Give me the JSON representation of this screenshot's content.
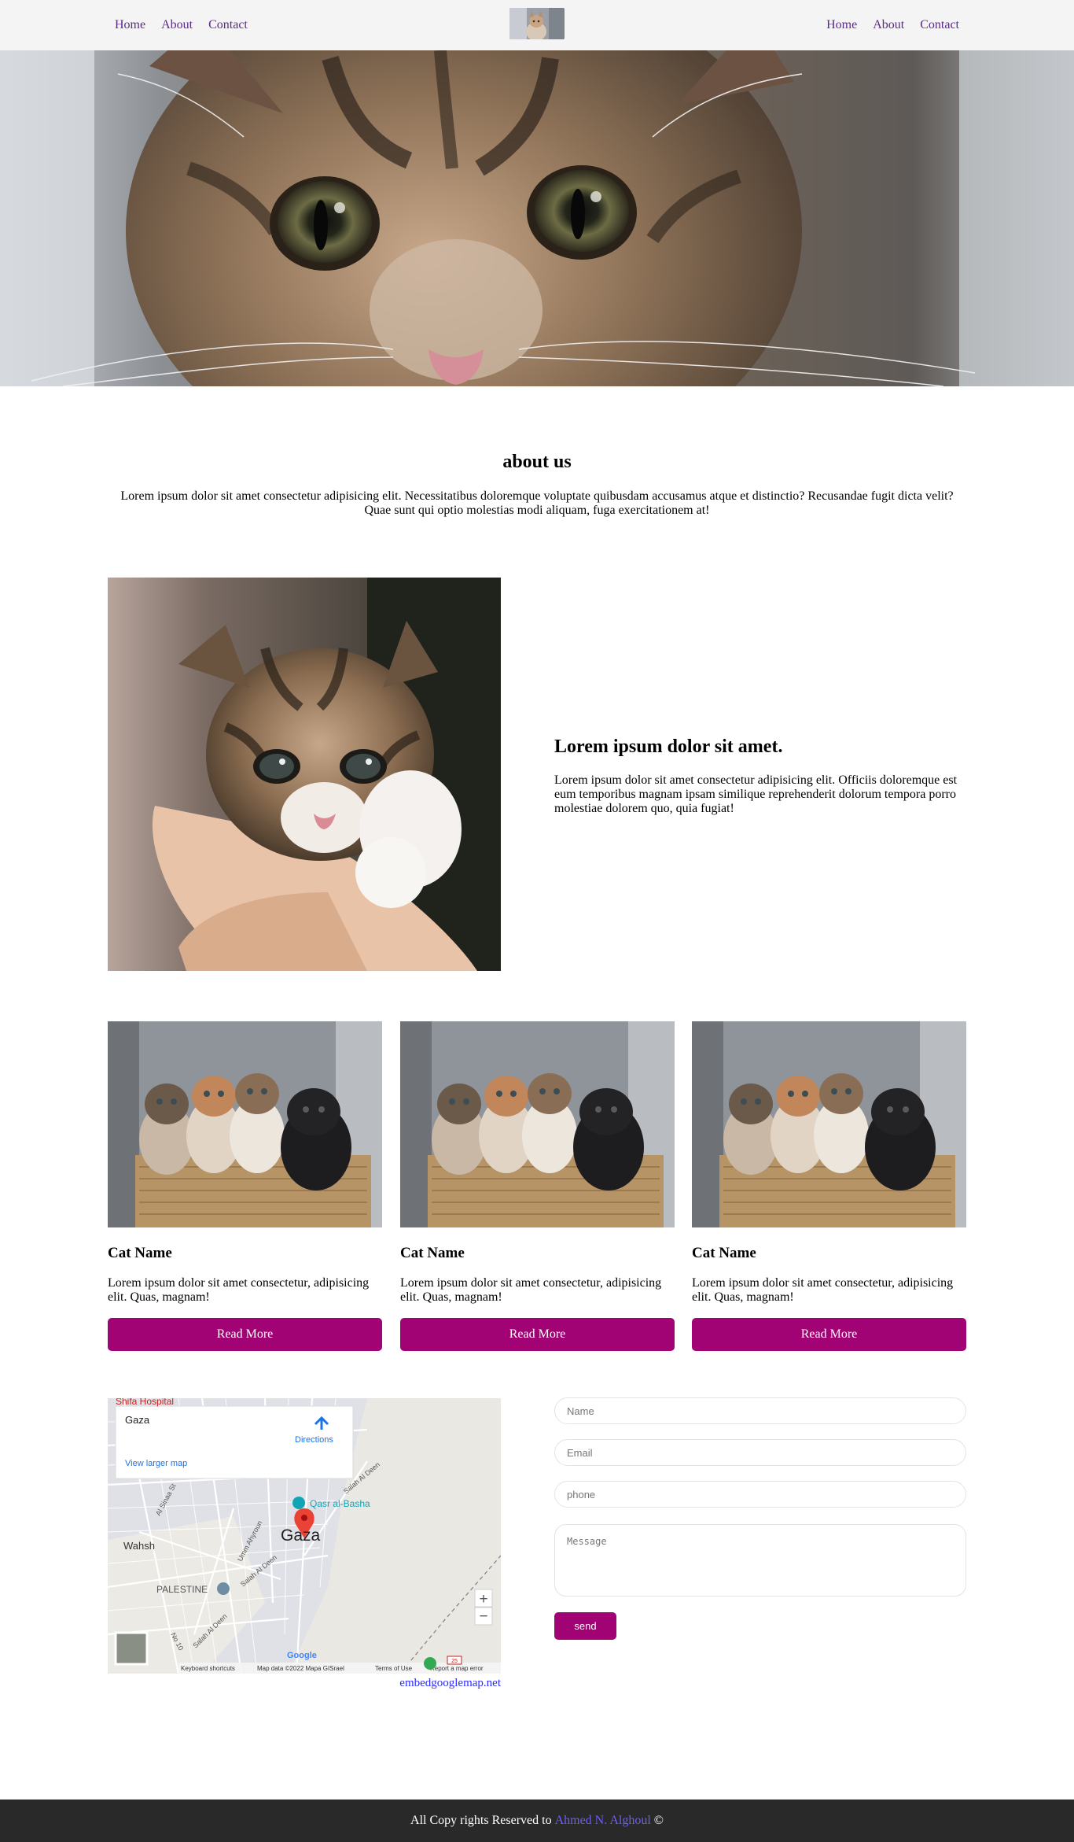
{
  "nav": {
    "left": [
      "Home",
      "About",
      "Contact"
    ],
    "right": [
      "Home",
      "About",
      "Contact"
    ]
  },
  "about": {
    "title": "about us",
    "text": "Lorem ipsum dolor sit amet consectetur adipisicing elit. Necessitatibus doloremque voluptate quibusdam accusamus atque et distinctio? Recusandae fugit dicta velit? Quae sunt qui optio molestias modi aliquam, fuga exercitationem at!"
  },
  "feature": {
    "title": "Lorem ipsum dolor sit amet.",
    "text": "Lorem ipsum dolor sit amet consectetur adipisicing elit. Officiis doloremque est eum temporibus magnam ipsam similique reprehenderit dolorum tempora porro molestiae dolorem quo, quia fugiat!"
  },
  "cards": [
    {
      "title": "Cat Name",
      "text": "Lorem ipsum dolor sit amet consectetur, adipisicing elit. Quas, magnam!",
      "button": "Read More"
    },
    {
      "title": "Cat Name",
      "text": "Lorem ipsum dolor sit amet consectetur, adipisicing elit. Quas, magnam!",
      "button": "Read More"
    },
    {
      "title": "Cat Name",
      "text": "Lorem ipsum dolor sit amet consectetur, adipisicing elit. Quas, magnam!",
      "button": "Read More"
    }
  ],
  "map": {
    "place": "Gaza",
    "directions": "Directions",
    "larger_map": "View larger map",
    "city_label": "Gaza",
    "poi": "Qasr al-Basha",
    "hospital": "Shifa Hospital",
    "area1": "Wahsh",
    "area2": "PALESTINE",
    "street1": "Al Sinaa St",
    "street2": "Umm Ahyroun",
    "street3": "Salah Al Deen",
    "street4": "Salah Al Deen",
    "street5": "No 10",
    "street6": "Salah Al Deen",
    "google": "Google",
    "shortcuts": "Keyboard shortcuts",
    "mapdata": "Map data ©2022 Mapa GISrael",
    "terms": "Terms of Use",
    "report": "Report a map error",
    "road_badge": "25",
    "zoom_in": "+",
    "zoom_out": "−",
    "link": "embedgooglemap.net"
  },
  "form": {
    "name_placeholder": "Name",
    "email_placeholder": "Email",
    "phone_placeholder": "phone",
    "message_placeholder": "Message",
    "send": "send"
  },
  "footer": {
    "prefix": "All Copy rights Reserved to",
    "author": "Ahmed N. Alghoul",
    "symbol": "©"
  },
  "colors": {
    "accent": "#a10374",
    "nav_link": "#5a2a8a",
    "footer_bg": "#292929",
    "author_link": "#6a5cff"
  }
}
